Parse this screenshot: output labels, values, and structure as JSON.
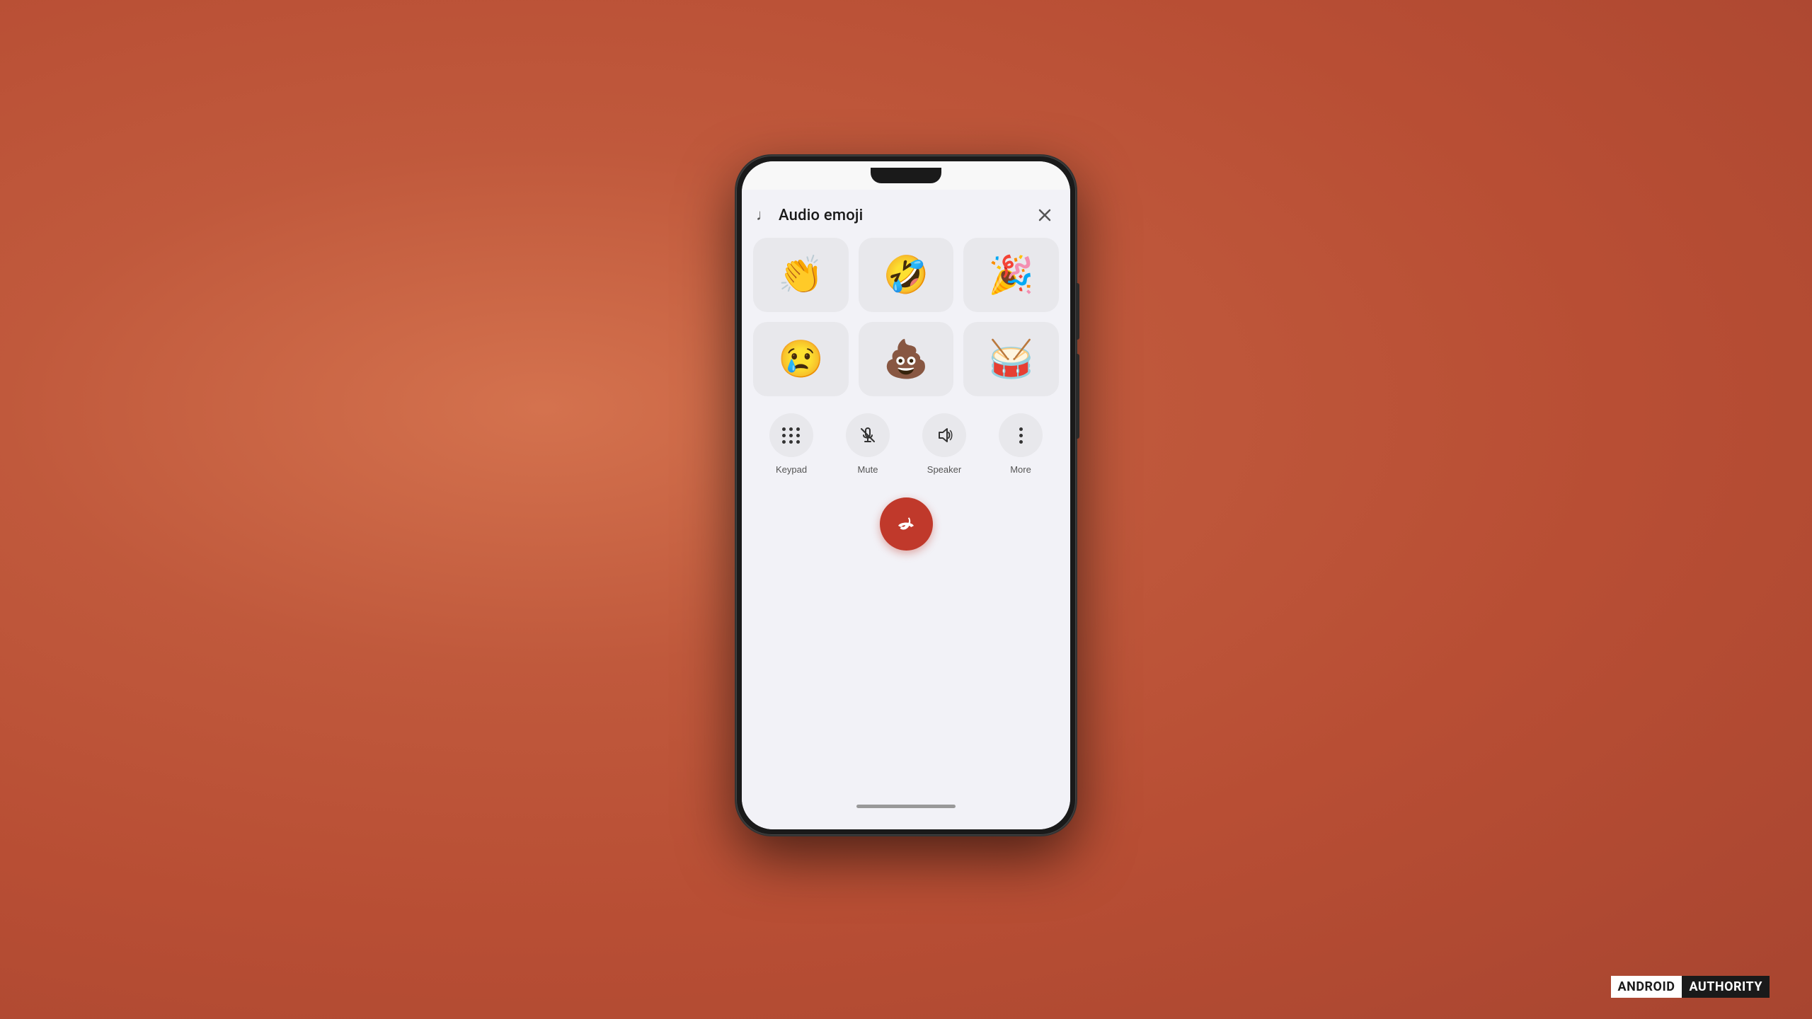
{
  "page": {
    "background_color": "#c46448"
  },
  "panel": {
    "title": "Audio emoji",
    "close_label": "×"
  },
  "emojis": {
    "row1": [
      {
        "id": "clapping",
        "symbol": "👏",
        "label": "Clapping hands"
      },
      {
        "id": "laughing",
        "symbol": "🤣",
        "label": "Laughing crying"
      },
      {
        "id": "party",
        "symbol": "🎉",
        "label": "Party popper"
      }
    ],
    "row2": [
      {
        "id": "sad",
        "symbol": "😢",
        "label": "Crying face"
      },
      {
        "id": "poop",
        "symbol": "💩",
        "label": "Pile of poo"
      },
      {
        "id": "drum",
        "symbol": "🥁",
        "label": "Drum"
      }
    ]
  },
  "controls": [
    {
      "id": "keypad",
      "label": "Keypad",
      "icon_type": "keypad"
    },
    {
      "id": "mute",
      "label": "Mute",
      "icon_type": "mute"
    },
    {
      "id": "speaker",
      "label": "Speaker",
      "icon_type": "speaker"
    },
    {
      "id": "more",
      "label": "More",
      "icon_type": "more"
    }
  ],
  "end_call": {
    "label": "End call",
    "color": "#c0392b"
  },
  "watermark": {
    "android": "ANDROID",
    "authority": "AUTHORITY"
  }
}
